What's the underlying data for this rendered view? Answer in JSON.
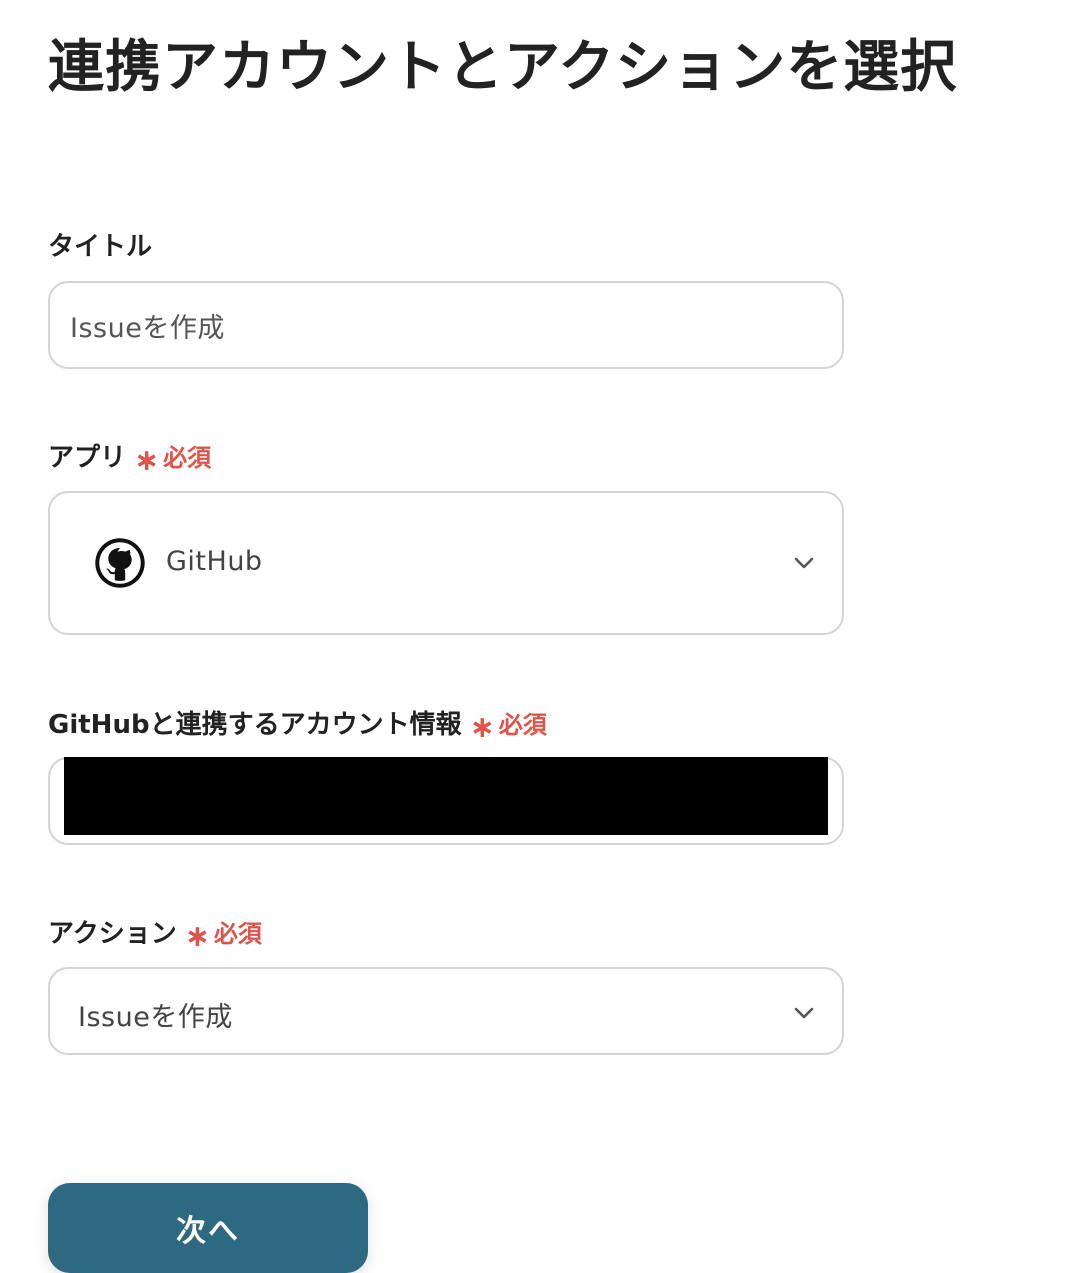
{
  "page": {
    "title": "連携アカウントとアクションを選択"
  },
  "fields": {
    "title": {
      "label": "タイトル",
      "value": "Issueを作成"
    },
    "app": {
      "label": "アプリ",
      "required_mark": "∗",
      "required_text": "必須",
      "value": "GitHub",
      "icon": "github-logo-icon"
    },
    "account": {
      "label": "GitHubと連携するアカウント情報",
      "required_mark": "∗",
      "required_text": "必須",
      "value_redacted": true
    },
    "action": {
      "label": "アクション",
      "required_mark": "∗",
      "required_text": "必須",
      "value": "Issueを作成"
    }
  },
  "buttons": {
    "next_label": "次へ"
  },
  "colors": {
    "primary": "#2d6980",
    "required": "#e0534a",
    "border": "#d4d4d6",
    "text": "#222222"
  }
}
